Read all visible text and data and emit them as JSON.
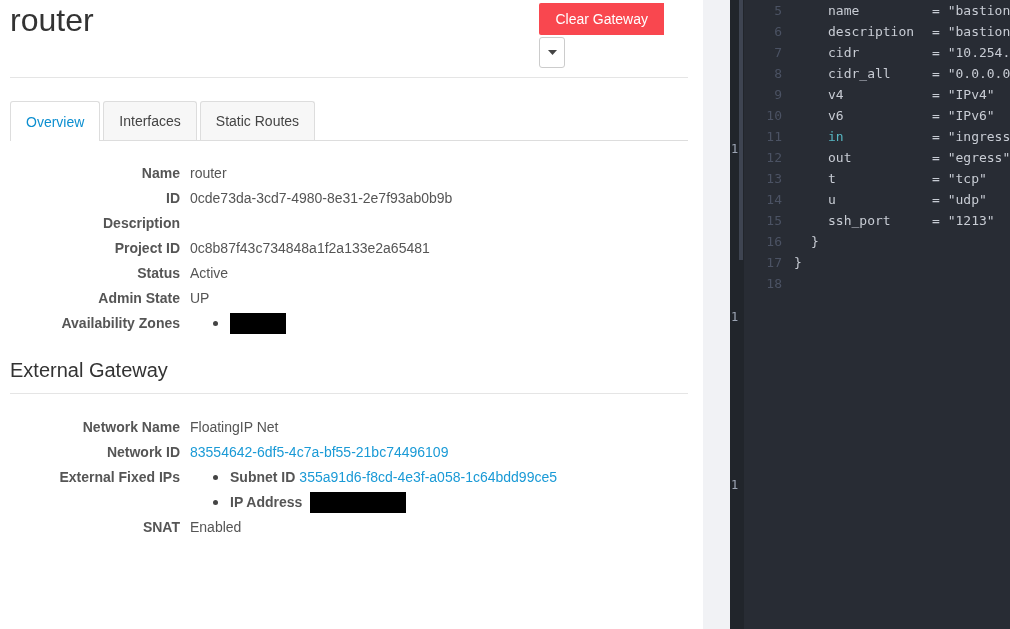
{
  "page": {
    "title": "router",
    "action_button": "Clear Gateway"
  },
  "tabs": [
    {
      "label": "Overview",
      "selected": true
    },
    {
      "label": "Interfaces",
      "selected": false
    },
    {
      "label": "Static Routes",
      "selected": false
    }
  ],
  "overview": [
    {
      "label": "Name",
      "value": "router",
      "kind": "text"
    },
    {
      "label": "ID",
      "value": "0cde73da-3cd7-4980-8e31-2e7f93ab0b9b",
      "kind": "text"
    },
    {
      "label": "Description",
      "kind": "text"
    },
    {
      "label": "Project ID",
      "value": "0c8b87f43c734848a1f2a133e2a65481",
      "kind": "text"
    },
    {
      "label": "Status",
      "value": "Active",
      "kind": "text"
    },
    {
      "label": "Admin State",
      "value": "UP",
      "kind": "text"
    },
    {
      "label": "Availability Zones",
      "kind": "redacted_list"
    }
  ],
  "external_gateway": {
    "heading": "External Gateway",
    "rows": [
      {
        "label": "Network Name",
        "value": "FloatingIP Net",
        "kind": "text"
      },
      {
        "label": "Network ID",
        "value": "83554642-6df5-4c7a-bf55-21bc74496109",
        "kind": "link"
      },
      {
        "label": "External Fixed IPs",
        "kind": "fixed_ips",
        "items": [
          {
            "label": "Subnet ID",
            "value": "355a91d6-f8cd-4e3f-a058-1c64bdd99ce5",
            "kind": "link"
          },
          {
            "label": "IP Address",
            "kind": "redacted"
          }
        ]
      },
      {
        "label": "SNAT",
        "value": "Enabled",
        "kind": "text"
      }
    ]
  },
  "editor": {
    "gutter_marks": [
      "1",
      "1",
      "1"
    ],
    "lines": [
      {
        "number": "5",
        "key": "name",
        "value": "= \"bastion",
        "kind": "assign"
      },
      {
        "number": "6",
        "key": "description",
        "value": "= \"bastion",
        "kind": "assign"
      },
      {
        "number": "7",
        "key": "cidr",
        "value": "= \"10.254.",
        "kind": "assign"
      },
      {
        "number": "8",
        "key": "cidr_all",
        "value": "= \"0.0.0.0",
        "kind": "assign"
      },
      {
        "number": "9",
        "key": "v4",
        "value": "= \"IPv4\"",
        "kind": "assign"
      },
      {
        "number": "10",
        "key": "v6",
        "value": "= \"IPv6\"",
        "kind": "assign"
      },
      {
        "number": "11",
        "key": "in",
        "value": "= \"ingress",
        "kind": "keyword_assign"
      },
      {
        "number": "12",
        "key": "out",
        "value": "= \"egress\"",
        "kind": "assign"
      },
      {
        "number": "13",
        "key": "t",
        "value": "= \"tcp\"",
        "kind": "assign"
      },
      {
        "number": "14",
        "key": "u",
        "value": "= \"udp\"",
        "kind": "assign"
      },
      {
        "number": "15",
        "key": "ssh_port",
        "value": "= \"1213\"",
        "kind": "assign"
      },
      {
        "number": "16",
        "key": "}",
        "kind": "inner_close"
      },
      {
        "number": "17",
        "key": "}",
        "kind": "outer_close"
      },
      {
        "number": "18",
        "kind": "empty"
      }
    ]
  }
}
